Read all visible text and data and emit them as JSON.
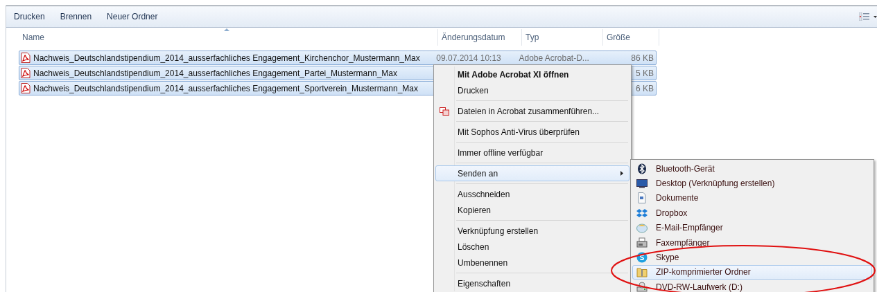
{
  "toolbar": {
    "buttons": [
      "Drucken",
      "Brennen",
      "Neuer Ordner"
    ]
  },
  "table": {
    "columns": [
      {
        "label": "Name",
        "sorted": true
      },
      {
        "label": "Änderungsdatum",
        "sorted": false
      },
      {
        "label": "Typ",
        "sorted": false
      },
      {
        "label": "Größe",
        "sorted": false
      }
    ],
    "rows": [
      {
        "name": "Nachweis_Deutschlandstipendium_2014_ausserfachliches Engagement_Kirchenchor_Mustermann_Max",
        "date": "09.07.2014 10:13",
        "type": "Adobe Acrobat-D...",
        "size": "86 KB",
        "selected": true
      },
      {
        "name": "Nachweis_Deutschlandstipendium_2014_ausserfachliches Engagement_Partei_Mustermann_Max",
        "size": "5 KB",
        "selected": true
      },
      {
        "name": "Nachweis_Deutschlandstipendium_2014_ausserfachliches Engagement_Sportverein_Mustermann_Max",
        "size": "6 KB",
        "selected": true
      }
    ]
  },
  "context_menu": {
    "groups": [
      [
        {
          "label": "Mit Adobe Acrobat XI öffnen",
          "kind": "default",
          "selected": false
        },
        {
          "label": "Drucken",
          "kind": "plain",
          "selected": false
        }
      ],
      [
        {
          "label": "Dateien in Acrobat zusammenführen...",
          "kind": "icon",
          "selected": false
        }
      ],
      [
        {
          "label": "Mit Sophos Anti-Virus überprüfen",
          "kind": "plain",
          "selected": false
        }
      ],
      [
        {
          "label": "Immer offline verfügbar",
          "kind": "plain",
          "selected": false
        }
      ],
      [
        {
          "label": "Senden an",
          "kind": "submenu",
          "selected": true
        }
      ],
      [
        {
          "label": "Ausschneiden",
          "kind": "plain",
          "selected": false
        },
        {
          "label": "Kopieren",
          "kind": "plain",
          "selected": false
        }
      ],
      [
        {
          "label": "Verknüpfung erstellen",
          "kind": "plain",
          "selected": false
        },
        {
          "label": "Löschen",
          "kind": "plain",
          "selected": false
        },
        {
          "label": "Umbenennen",
          "kind": "plain",
          "selected": false
        }
      ],
      [
        {
          "label": "Eigenschaften",
          "kind": "plain",
          "selected": false
        }
      ]
    ]
  },
  "submenu": {
    "items": [
      {
        "label": "Bluetooth-Gerät",
        "selected": false
      },
      {
        "label": "Desktop (Verknüpfung erstellen)",
        "selected": false
      },
      {
        "label": "Dokumente",
        "selected": false
      },
      {
        "label": "Dropbox",
        "selected": false
      },
      {
        "label": "E-Mail-Empfänger",
        "selected": false
      },
      {
        "label": "Faxempfänger",
        "selected": false
      },
      {
        "label": "Skype",
        "selected": false
      },
      {
        "label": "ZIP-komprimierter Ordner",
        "selected": true
      },
      {
        "label": "DVD-RW-Laufwerk (D:)",
        "selected": false
      }
    ]
  }
}
